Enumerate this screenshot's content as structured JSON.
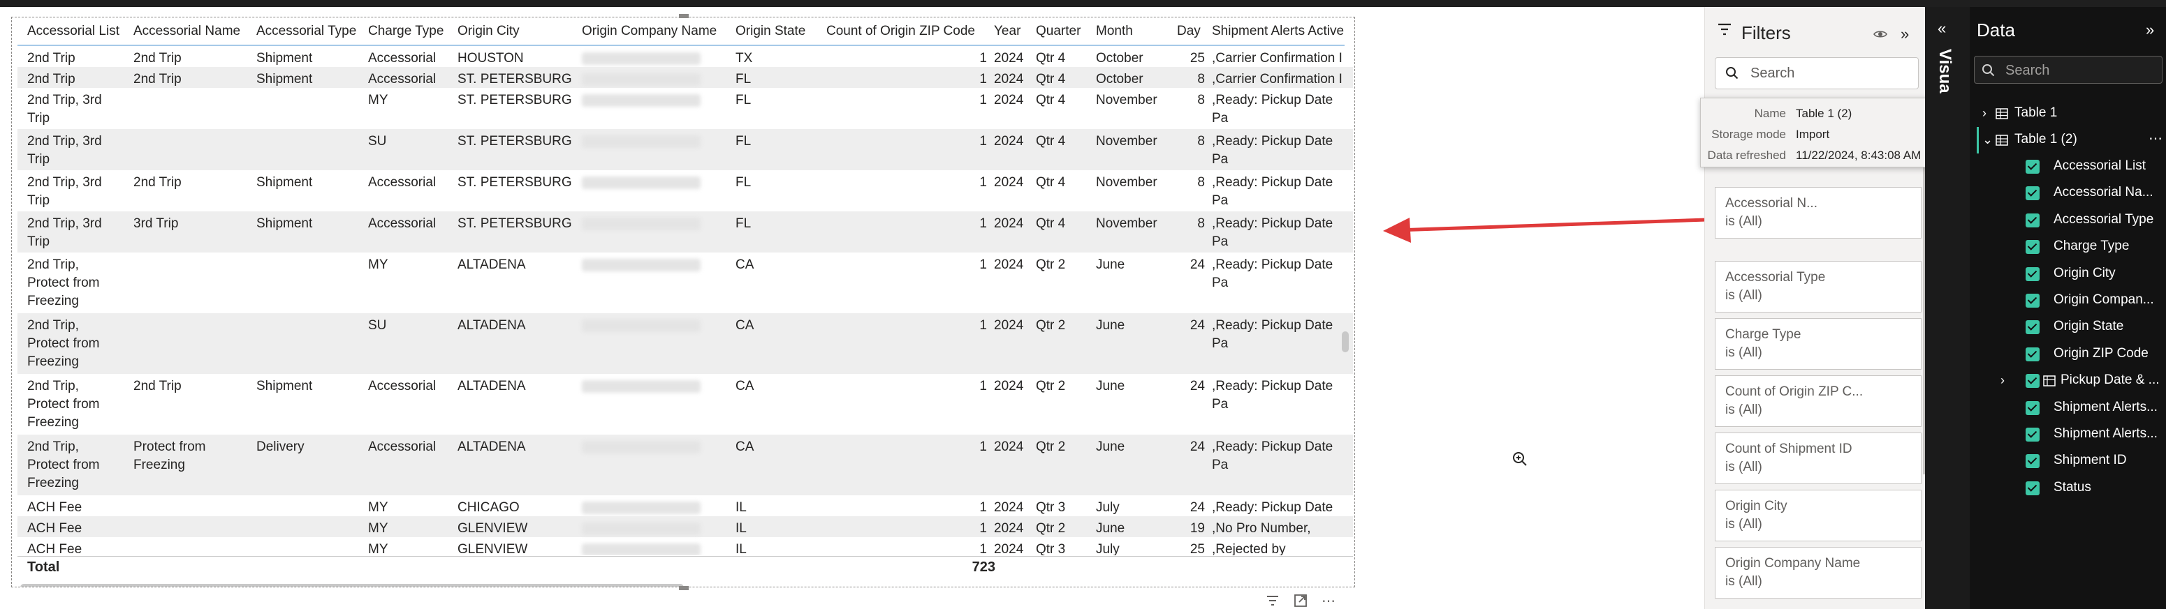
{
  "table": {
    "columns": [
      {
        "label": "Accessorial List"
      },
      {
        "label": "Accessorial Name"
      },
      {
        "label": "Accessorial Type"
      },
      {
        "label": "Charge Type"
      },
      {
        "label": "Origin City"
      },
      {
        "label": "Origin Company Name"
      },
      {
        "label": "Origin State"
      },
      {
        "label": "Count of Origin ZIP Code"
      },
      {
        "label": "Year"
      },
      {
        "label": "Quarter"
      },
      {
        "label": "Month"
      },
      {
        "label": "Day"
      },
      {
        "label": "Shipment Alerts Active"
      }
    ],
    "rows": [
      {
        "c": [
          "2nd Trip",
          "2nd Trip",
          "Shipment",
          "Accessorial",
          "HOUSTON",
          "",
          "TX",
          "1",
          "2024",
          "Qtr 4",
          "October",
          "25",
          ",Carrier Confirmation I"
        ]
      },
      {
        "c": [
          "2nd Trip",
          "2nd Trip",
          "Shipment",
          "Accessorial",
          "ST. PETERSBURG",
          "",
          "FL",
          "1",
          "2024",
          "Qtr 4",
          "October",
          "8",
          ",Carrier Confirmation I"
        ]
      },
      {
        "c": [
          "2nd Trip, 3rd\nTrip",
          "",
          "",
          "MY",
          "ST. PETERSBURG",
          "",
          "FL",
          "1",
          "2024",
          "Qtr 4",
          "November",
          "8",
          ",Ready: Pickup Date Pa"
        ]
      },
      {
        "c": [
          "2nd Trip, 3rd\nTrip",
          "",
          "",
          "SU",
          "ST. PETERSBURG",
          "",
          "FL",
          "1",
          "2024",
          "Qtr 4",
          "November",
          "8",
          ",Ready: Pickup Date Pa"
        ]
      },
      {
        "c": [
          "2nd Trip, 3rd\nTrip",
          "2nd Trip",
          "Shipment",
          "Accessorial",
          "ST. PETERSBURG",
          "",
          "FL",
          "1",
          "2024",
          "Qtr 4",
          "November",
          "8",
          ",Ready: Pickup Date Pa"
        ]
      },
      {
        "c": [
          "2nd Trip, 3rd\nTrip",
          "3rd Trip",
          "Shipment",
          "Accessorial",
          "ST. PETERSBURG",
          "",
          "FL",
          "1",
          "2024",
          "Qtr 4",
          "November",
          "8",
          ",Ready: Pickup Date Pa"
        ]
      },
      {
        "c": [
          "2nd Trip,\nProtect from\nFreezing",
          "",
          "",
          "MY",
          "ALTADENA",
          "",
          "CA",
          "1",
          "2024",
          "Qtr 2",
          "June",
          "24",
          ",Ready: Pickup Date Pa"
        ]
      },
      {
        "c": [
          "2nd Trip,\nProtect from\nFreezing",
          "",
          "",
          "SU",
          "ALTADENA",
          "",
          "CA",
          "1",
          "2024",
          "Qtr 2",
          "June",
          "24",
          ",Ready: Pickup Date Pa"
        ]
      },
      {
        "c": [
          "2nd Trip,\nProtect from\nFreezing",
          "2nd Trip",
          "Shipment",
          "Accessorial",
          "ALTADENA",
          "",
          "CA",
          "1",
          "2024",
          "Qtr 2",
          "June",
          "24",
          ",Ready: Pickup Date Pa"
        ]
      },
      {
        "c": [
          "2nd Trip,\nProtect from\nFreezing",
          "Protect from\nFreezing",
          "Delivery",
          "Accessorial",
          "ALTADENA",
          "",
          "CA",
          "1",
          "2024",
          "Qtr 2",
          "June",
          "24",
          ",Ready: Pickup Date Pa"
        ]
      },
      {
        "c": [
          "ACH Fee",
          "",
          "",
          "MY",
          "CHICAGO",
          "",
          "IL",
          "1",
          "2024",
          "Qtr 3",
          "July",
          "24",
          ",Ready: Pickup Date Pa"
        ]
      },
      {
        "c": [
          "ACH Fee",
          "",
          "",
          "MY",
          "GLENVIEW",
          "",
          "IL",
          "1",
          "2024",
          "Qtr 2",
          "June",
          "19",
          ",No Pro Number,"
        ]
      },
      {
        "c": [
          "ACH Fee",
          "",
          "",
          "MY",
          "GLENVIEW",
          "",
          "IL",
          "1",
          "2024",
          "Qtr 3",
          "July",
          "25",
          ",Rejected by Carrier,Re"
        ]
      }
    ],
    "total_label": "Total",
    "total_value": "723"
  },
  "filters": {
    "title": "Filters",
    "search_placeholder": "Search",
    "cards": [
      {
        "name": "",
        "value": "is (All)"
      },
      {
        "name": "Accessorial N...",
        "value": "is (All)"
      },
      {
        "name": "Accessorial Type",
        "value": "is (All)"
      },
      {
        "name": "Charge Type",
        "value": "is (All)"
      },
      {
        "name": "Count of Origin ZIP C...",
        "value": "is (All)"
      },
      {
        "name": "Count of Shipment ID",
        "value": "is (All)"
      },
      {
        "name": "Origin City",
        "value": "is (All)"
      },
      {
        "name": "Origin Company Name",
        "value": "is (All)"
      }
    ]
  },
  "tooltip": {
    "name_key": "Name",
    "name_val": "Table 1 (2)",
    "storage_key": "Storage mode",
    "storage_val": "Import",
    "refreshed_key": "Data refreshed",
    "refreshed_val": "11/22/2024, 8:43:08 AM"
  },
  "visualizations": {
    "label": "Visua"
  },
  "data_pane": {
    "title": "Data",
    "search_placeholder": "Search",
    "tables": [
      {
        "label": "Table 1",
        "expanded": false
      },
      {
        "label": "Table 1 (2)",
        "expanded": true
      }
    ],
    "fields": [
      {
        "label": "Accessorial List"
      },
      {
        "label": "Accessorial Na..."
      },
      {
        "label": "Accessorial Type"
      },
      {
        "label": "Charge Type"
      },
      {
        "label": "Origin City"
      },
      {
        "label": "Origin Compan..."
      },
      {
        "label": "Origin State"
      },
      {
        "label": "Origin ZIP Code"
      },
      {
        "label": "Pickup Date & ..."
      },
      {
        "label": "Shipment Alerts..."
      },
      {
        "label": "Shipment Alerts..."
      },
      {
        "label": "Shipment ID"
      },
      {
        "label": "Status"
      }
    ]
  },
  "colors": {
    "accent_green": "#3cc6a5",
    "arrow_red": "#e03a3a",
    "row_alt": "#eeeeee",
    "pane_dark": "#121212"
  }
}
